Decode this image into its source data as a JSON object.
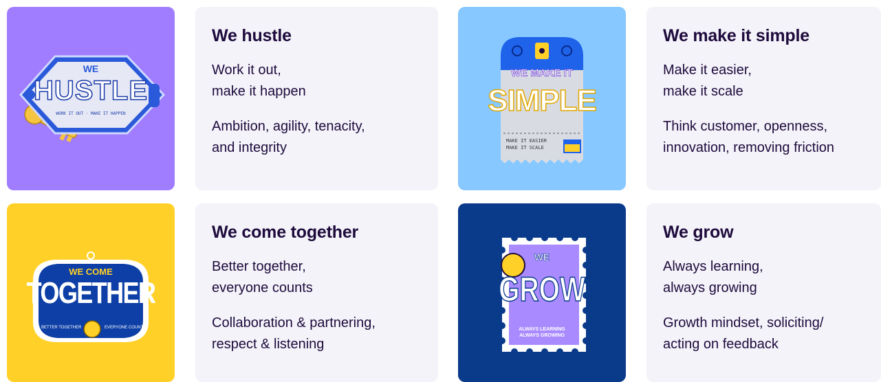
{
  "colors": {
    "hustle_bg": "#a07cff",
    "simple_bg": "#86c8ff",
    "together_bg": "#ffd128",
    "grow_bg": "#0a3a8a",
    "card_bg": "#f3f3f9",
    "text": "#1e0a3c"
  },
  "cards": [
    {
      "title": "We hustle",
      "motto": [
        "Work it out,",
        "make it happen"
      ],
      "values": [
        "Ambition, agility, tenacity,",
        "and integrity"
      ],
      "badge": {
        "small": "WE",
        "big": "HUSTLE",
        "tagline": "WORK IT OUT · MAKE IT HAPPEN",
        "icon": "keychain-key-icon"
      }
    },
    {
      "title": "We make it simple",
      "motto": [
        "Make it easier,",
        "make it scale"
      ],
      "values": [
        "Think customer, openness,",
        "innovation, removing friction"
      ],
      "badge": {
        "small": "WE MAKE IT",
        "big": "SIMPLE",
        "tagline1": "MAKE IT EASIER",
        "tagline2": "MAKE IT SCALE",
        "icon": "ticket-tag-icon"
      }
    },
    {
      "title": "We come together",
      "motto": [
        "Better together,",
        "everyone counts"
      ],
      "values": [
        "Collaboration & partnering,",
        "respect & listening"
      ],
      "badge": {
        "small": "WE COME",
        "big": "TOGETHER",
        "tagline1": "BETTER TOGETHER",
        "tagline2": "EVERYONE COUNTS",
        "icon": "badge-patch-icon"
      }
    },
    {
      "title": "We grow",
      "motto": [
        "Always learning,",
        "always growing"
      ],
      "values": [
        "Growth mindset, soliciting/",
        "acting on feedback"
      ],
      "badge": {
        "small": "WE",
        "big": "GROW",
        "tagline1": "ALWAYS LEARNING",
        "tagline2": "ALWAYS GROWING",
        "icon": "stamp-icon"
      }
    }
  ]
}
